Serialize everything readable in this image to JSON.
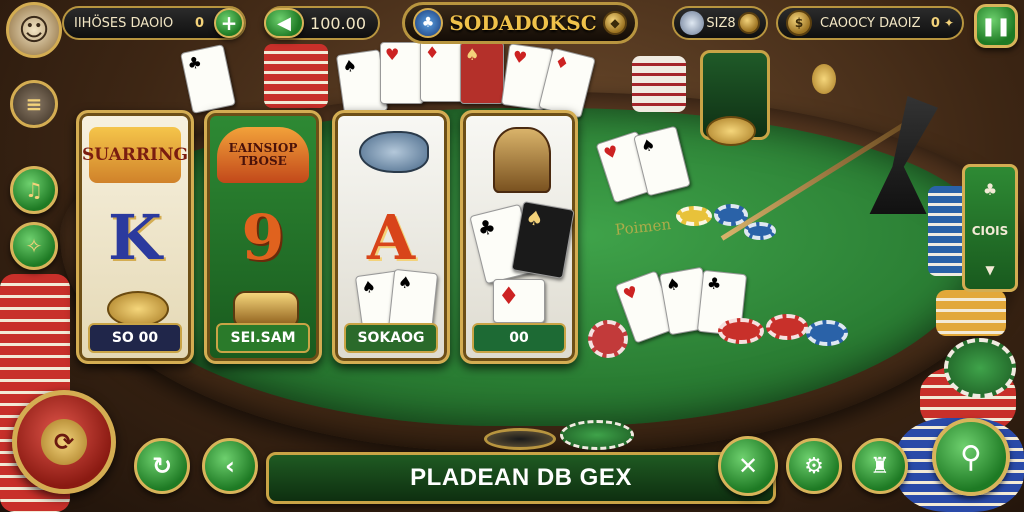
{
  "player": {
    "name": "IIHÖSES DAOIO",
    "balance": "0",
    "add_icon": "plus-icon"
  },
  "bet": {
    "value": "100.00",
    "back_icon": "arrow-left-icon"
  },
  "title": {
    "text": "SODADOKSC",
    "logo_icon": "casino-logo-icon"
  },
  "coins": {
    "value": "SIZ8",
    "icon": "globe-coin-icon"
  },
  "bonus": {
    "label": "CAOOCY DAOIZ",
    "value": "0"
  },
  "reels": [
    {
      "banner": "SUARRING",
      "symbol": "K",
      "symbol_color": "#2b3a9e",
      "label": "SO 00",
      "label_bg": "#20264a"
    },
    {
      "banner": "EAINSIOP TBOSE",
      "symbol": "9",
      "symbol_color": "#d2581a",
      "label": "SEI.SAM",
      "label_bg": "#2a7a2a"
    },
    {
      "banner": "",
      "symbol": "A",
      "symbol_color": "#d8441a",
      "label": "SOKAOG",
      "label_bg": "#2a6a2a"
    },
    {
      "banner": "",
      "symbol": "",
      "symbol_color": "#222222",
      "label": "00",
      "label_bg": "#1d6a34"
    }
  ],
  "felt_text": "Poimen",
  "side_panel": {
    "label": "CIOIS"
  },
  "bottom_bar": {
    "text": "PLADEAN DB GEX"
  },
  "colors": {
    "accent_gold": "#d4ad52",
    "felt_green": "#2a7d33",
    "button_green": "#1e7a24",
    "spin_red": "#b3261e"
  }
}
